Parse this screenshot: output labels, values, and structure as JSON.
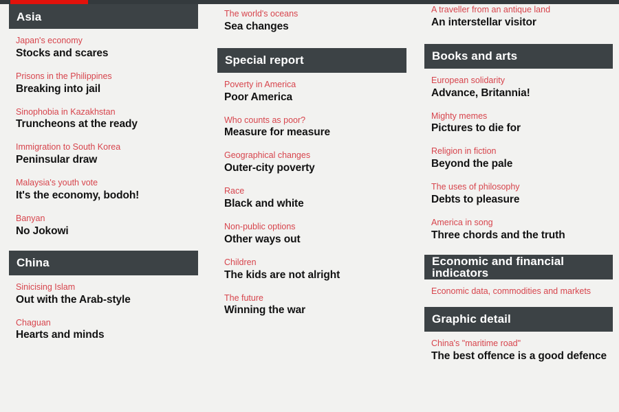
{
  "page": {
    "background_color": "#f2f2f0",
    "accent_color": "#e3120b",
    "rubric_color": "#d7444c",
    "header_bar_color": "#3c4245",
    "headline_color": "#121212"
  },
  "topbar": {
    "name": "progress-bar"
  },
  "columns": {
    "left": {
      "orphan_articles": [],
      "sections": [
        {
          "title": "Asia",
          "articles": [
            {
              "rubric": "Japan's economy",
              "headline": "Stocks and scares"
            },
            {
              "rubric": "Prisons in the Philippines",
              "headline": "Breaking into jail"
            },
            {
              "rubric": "Sinophobia in Kazakhstan",
              "headline": "Truncheons at the ready"
            },
            {
              "rubric": "Immigration to South Korea",
              "headline": "Peninsular draw"
            },
            {
              "rubric": "Malaysia's youth vote",
              "headline": "It's the economy, bodoh!"
            },
            {
              "rubric": "Banyan",
              "headline": "No Jokowi"
            }
          ]
        },
        {
          "title": "China",
          "articles": [
            {
              "rubric": "Sinicising Islam",
              "headline": "Out with the Arab-style"
            },
            {
              "rubric": "Chaguan",
              "headline": "Hearts and minds"
            }
          ]
        }
      ]
    },
    "middle": {
      "orphan_articles": [
        {
          "rubric": "The world's oceans",
          "headline": "Sea changes"
        }
      ],
      "sections": [
        {
          "title": "Special report",
          "articles": [
            {
              "rubric": "Poverty in America",
              "headline": "Poor America"
            },
            {
              "rubric": "Who counts as poor?",
              "headline": "Measure for measure"
            },
            {
              "rubric": "Geographical changes",
              "headline": "Outer-city poverty"
            },
            {
              "rubric": "Race",
              "headline": "Black and white"
            },
            {
              "rubric": "Non-public options",
              "headline": "Other ways out"
            },
            {
              "rubric": "Children",
              "headline": "The kids are not alright"
            },
            {
              "rubric": "The future",
              "headline": "Winning the war"
            }
          ]
        }
      ]
    },
    "right": {
      "orphan_articles": [
        {
          "rubric": "A traveller from an antique land",
          "headline": "An interstellar visitor"
        }
      ],
      "sections": [
        {
          "title": "Books and arts",
          "articles": [
            {
              "rubric": "European solidarity",
              "headline": "Advance, Britannia!"
            },
            {
              "rubric": "Mighty memes",
              "headline": "Pictures to die for"
            },
            {
              "rubric": "Religion in fiction",
              "headline": "Beyond the pale"
            },
            {
              "rubric": "The uses of philosophy",
              "headline": "Debts to pleasure"
            },
            {
              "rubric": "America in song",
              "headline": "Three chords and the truth"
            }
          ]
        },
        {
          "title": "Economic and financial indicators",
          "articles": [
            {
              "rubric": "Economic data, commodities and markets",
              "headline": ""
            }
          ]
        },
        {
          "title": "Graphic detail",
          "articles": [
            {
              "rubric": "China's \"maritime road\"",
              "headline": "The best offence is a good defence"
            }
          ]
        }
      ]
    }
  }
}
